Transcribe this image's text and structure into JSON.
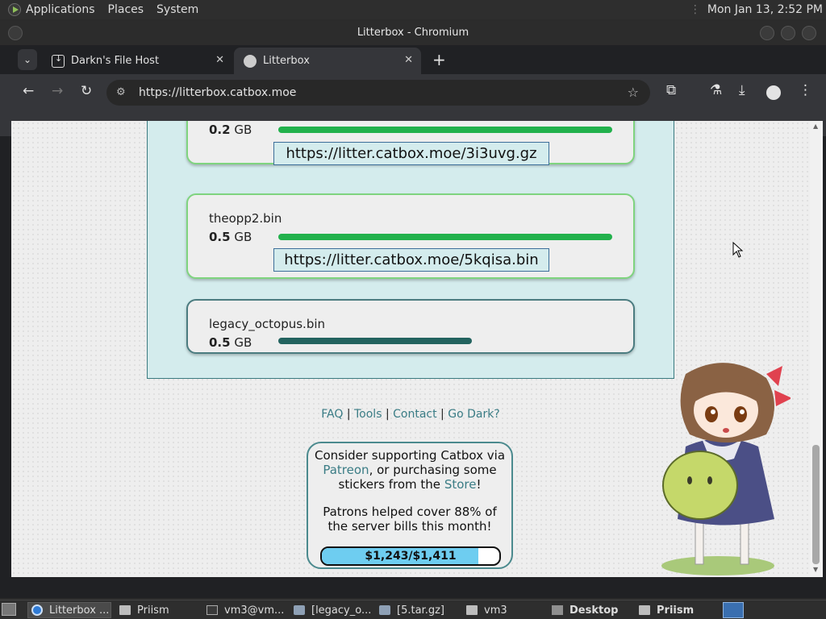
{
  "top_panel": {
    "menus": [
      "Applications",
      "Places",
      "System"
    ],
    "clock": "Mon Jan 13,  2:52 PM"
  },
  "window": {
    "title": "Litterbox - Chromium",
    "tabs": [
      {
        "title": "Darkn's File Host",
        "icon": "download-icon"
      },
      {
        "title": "Litterbox",
        "icon": "catbox-icon"
      }
    ],
    "url": "https://litterbox.catbox.moe"
  },
  "page": {
    "uploads": [
      {
        "name": "",
        "size_num": "0.2",
        "size_unit": "GB",
        "progress": 1.0,
        "link": "https://litter.catbox.moe/3i3uvg.gz",
        "complete": true
      },
      {
        "name": "theopp2.bin",
        "size_num": "0.5",
        "size_unit": "GB",
        "progress": 1.0,
        "link": "https://litter.catbox.moe/5kqisa.bin",
        "complete": true
      },
      {
        "name": "legacy_octopus.bin",
        "size_num": "0.5",
        "size_unit": "GB",
        "progress": 0.58,
        "link": "",
        "complete": false
      }
    ],
    "footer_links": {
      "faq": "FAQ",
      "tools": "Tools",
      "contact": "Contact",
      "dark": "Go Dark?",
      "sep": " | "
    },
    "support": {
      "line1": "Consider supporting Catbox via",
      "patreon": "Patreon",
      "line2": ", or purchasing some stickers from the",
      "store": "Store",
      "line3": "!",
      "patrons": "Patrons helped cover 88% of the server bills this month!",
      "goal_text": "$1,243/$1,411",
      "goal_fraction": 0.88
    }
  },
  "taskbar": {
    "items": [
      {
        "label": "Litterbox ...",
        "icon": "chrome-icon"
      },
      {
        "label": "Priism",
        "icon": "folder-icon"
      },
      {
        "label": "vm3@vm...",
        "icon": "terminal-icon"
      },
      {
        "label": "[legacy_o...",
        "icon": "archive-icon"
      },
      {
        "label": "[5.tar.gz]",
        "icon": "archive-icon"
      },
      {
        "label": "vm3",
        "icon": "folder-icon"
      },
      {
        "label": "Desktop",
        "icon": "folder-icon"
      },
      {
        "label": "Priism",
        "icon": "folder-icon"
      }
    ]
  },
  "colors": {
    "progress_done": "#22b14c",
    "progress_active": "#23635f",
    "goal_fill": "#6ecdf0",
    "link": "#3a7c85"
  }
}
